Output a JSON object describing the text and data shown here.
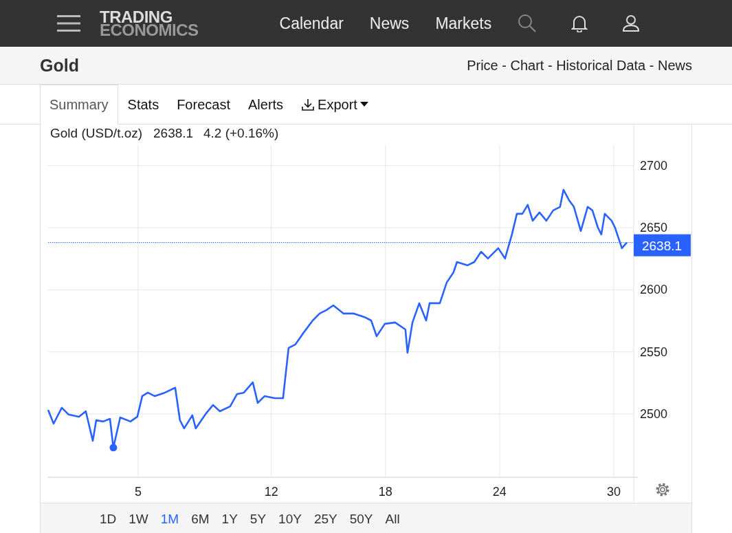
{
  "header": {
    "logo_top": "TRADING",
    "logo_bottom": "ECONOMICS",
    "nav": [
      "Calendar",
      "News",
      "Markets"
    ]
  },
  "title_bar": {
    "title": "Gold",
    "links": "Price - Chart - Historical Data - News"
  },
  "tabs": [
    {
      "label": "Summary",
      "selected": true
    },
    {
      "label": "Stats",
      "selected": false
    },
    {
      "label": "Forecast",
      "selected": false
    },
    {
      "label": "Alerts",
      "selected": false
    },
    {
      "label": "Export",
      "selected": false,
      "kind": "dropdown"
    }
  ],
  "legend": {
    "price": "2638.1",
    "change": "4.2 (+0.16%)"
  },
  "current_price_label": "2638.1",
  "chart_data": {
    "type": "line",
    "grid": true,
    "ref_lines": [
      {
        "axis": "y",
        "value": 2638.1,
        "color": "#2962ff"
      }
    ],
    "xlim": [
      0.27,
      31.16
    ],
    "ylim": [
      2449,
      2716
    ],
    "xticks": [
      5,
      12,
      18,
      24,
      30
    ],
    "yticks": [
      2500,
      2550,
      2600,
      2650,
      2700
    ],
    "x": [
      0.27,
      0.56,
      0.99,
      1.35,
      1.89,
      2.25,
      2.62,
      2.8,
      3.16,
      3.52,
      3.7,
      4.06,
      4.6,
      4.96,
      5.22,
      5.51,
      5.87,
      6.41,
      6.95,
      7.2,
      7.42,
      7.85,
      8.03,
      8.58,
      8.94,
      9.3,
      9.84,
      10.2,
      10.56,
      11.03,
      11.29,
      11.65,
      12.19,
      12.62,
      12.91,
      13.27,
      13.64,
      14.18,
      14.54,
      14.9,
      15.26,
      15.8,
      16.34,
      16.89,
      17.25,
      17.54,
      17.97,
      18.51,
      19.05,
      19.16,
      19.42,
      19.78,
      20.14,
      20.32,
      20.86,
      21.22,
      21.58,
      21.76,
      22.31,
      22.67,
      23.03,
      23.39,
      23.93,
      24.29,
      24.65,
      24.91,
      25.2,
      25.48,
      25.74,
      26.1,
      26.46,
      26.82,
      27.18,
      27.36,
      27.65,
      27.91,
      28.27,
      28.63,
      28.88,
      29.17,
      29.35,
      29.53,
      29.89,
      30.07,
      30.25,
      30.43,
      30.69
    ],
    "series": [
      {
        "name": "Gold (USD/t.oz)",
        "color": "#2962ff",
        "values": [
          2503.3,
          2492.2,
          2505,
          2499.5,
          2497.8,
          2502.2,
          2478.4,
          2495,
          2493.9,
          2496.1,
          2472.9,
          2497.2,
          2493.9,
          2497.8,
          2514.4,
          2517.2,
          2514.4,
          2517.2,
          2521.1,
          2495,
          2488.4,
          2498.9,
          2488.4,
          2500.6,
          2507.2,
          2502.2,
          2506.1,
          2516.1,
          2517.2,
          2525.5,
          2508.9,
          2514.4,
          2512.7,
          2512.7,
          2553.2,
          2556,
          2564.3,
          2575.3,
          2580.9,
          2583.7,
          2587.5,
          2580.9,
          2580.9,
          2578.1,
          2575.3,
          2562.6,
          2572.6,
          2573.7,
          2568.1,
          2549.3,
          2573.7,
          2589.2,
          2575.3,
          2589.2,
          2589.2,
          2605.8,
          2614.1,
          2622.4,
          2619.7,
          2622.4,
          2630.7,
          2625.2,
          2633.5,
          2625.2,
          2644.6,
          2661.2,
          2661.2,
          2668.4,
          2655.7,
          2662.3,
          2655.7,
          2664,
          2666.8,
          2680.6,
          2672.3,
          2666.8,
          2647.4,
          2666.8,
          2664,
          2650.1,
          2644.6,
          2661.2,
          2655.7,
          2650.1,
          2641.8,
          2633.5,
          2638.1
        ]
      }
    ]
  },
  "ranges": [
    {
      "label": "1D",
      "selected": false
    },
    {
      "label": "1W",
      "selected": false
    },
    {
      "label": "1M",
      "selected": true
    },
    {
      "label": "6M",
      "selected": false
    },
    {
      "label": "1Y",
      "selected": false
    },
    {
      "label": "5Y",
      "selected": false
    },
    {
      "label": "10Y",
      "selected": false
    },
    {
      "label": "25Y",
      "selected": false
    },
    {
      "label": "50Y",
      "selected": false
    },
    {
      "label": "All",
      "selected": false
    }
  ]
}
